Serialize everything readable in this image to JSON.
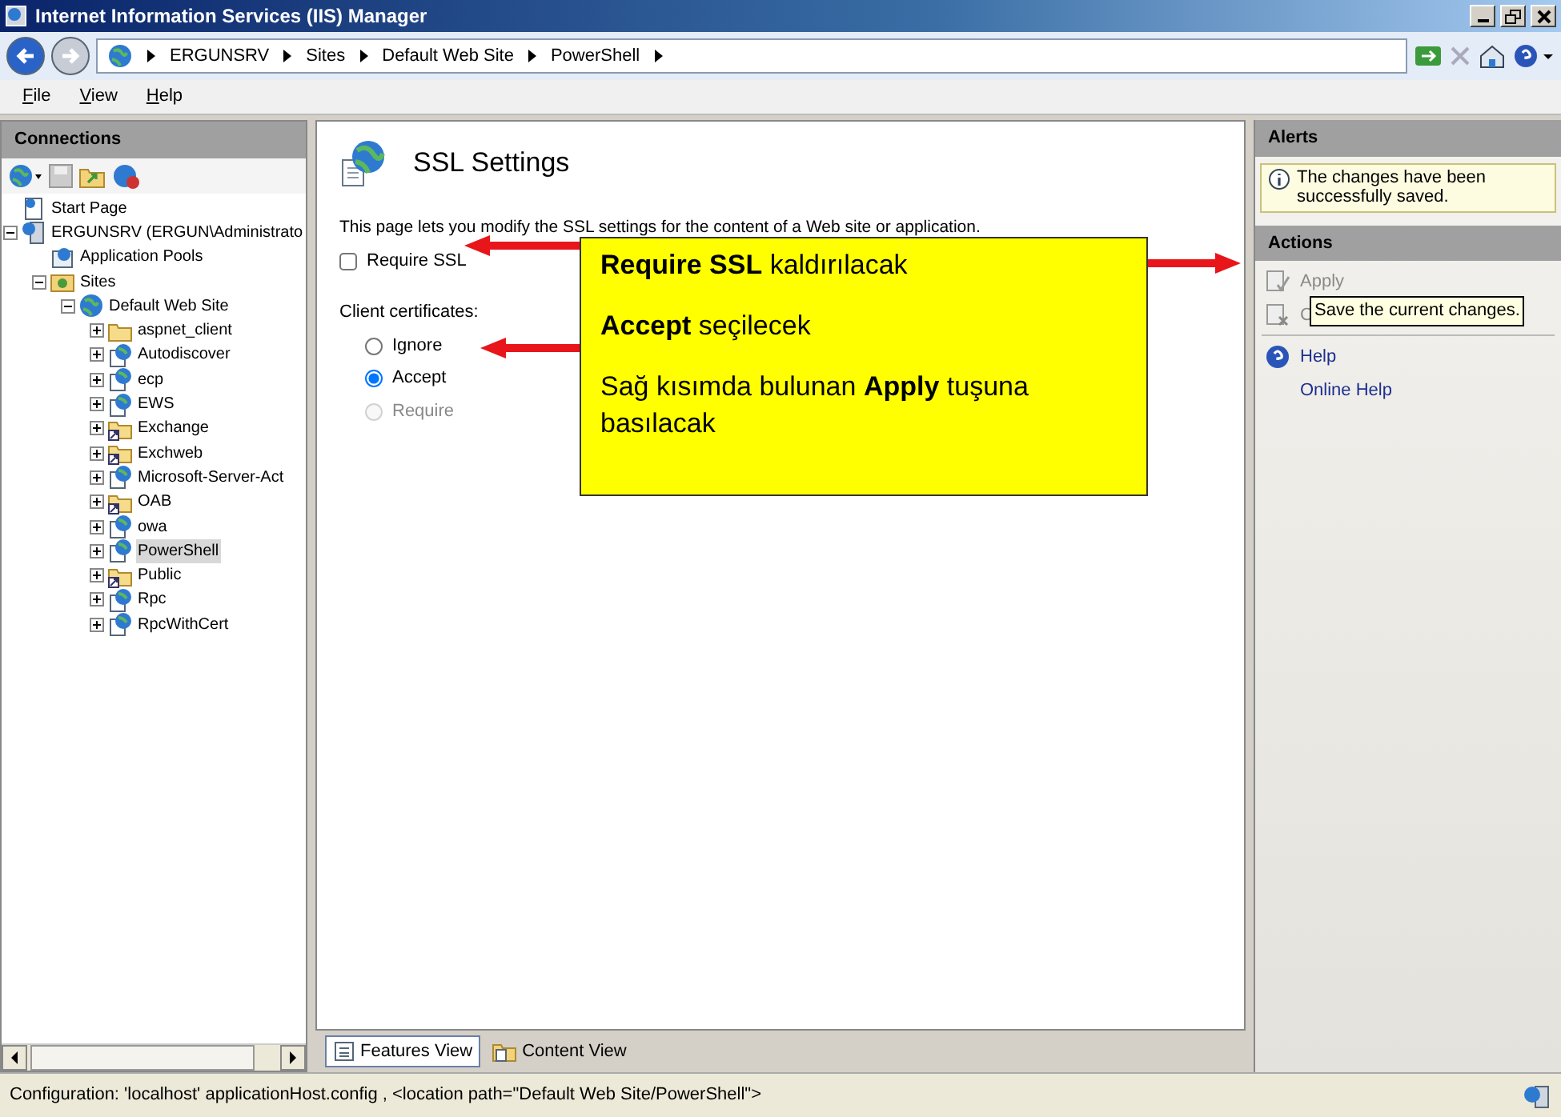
{
  "window": {
    "title": "Internet Information Services (IIS) Manager"
  },
  "address": {
    "segments": [
      "ERGUNSRV",
      "Sites",
      "Default Web Site",
      "PowerShell"
    ]
  },
  "menu": [
    "File",
    "View",
    "Help"
  ],
  "connections": {
    "title": "Connections",
    "tree": [
      {
        "label": "Start Page",
        "kind": "page",
        "selected": false
      },
      {
        "label": "ERGUNSRV (ERGUN\\Administrato",
        "kind": "server",
        "selected": false,
        "expanded": true,
        "children": [
          {
            "label": "Application Pools",
            "kind": "pool",
            "selected": false
          },
          {
            "label": "Sites",
            "kind": "sites",
            "selected": false,
            "expanded": true,
            "children": [
              {
                "label": "Default Web Site",
                "kind": "globe",
                "selected": false,
                "expanded": true,
                "children": [
                  {
                    "label": "aspnet_client",
                    "kind": "folder",
                    "selected": false,
                    "expanded": false
                  },
                  {
                    "label": "Autodiscover",
                    "kind": "app",
                    "selected": false,
                    "expanded": false
                  },
                  {
                    "label": "ecp",
                    "kind": "app",
                    "selected": false,
                    "expanded": false
                  },
                  {
                    "label": "EWS",
                    "kind": "app",
                    "selected": false,
                    "expanded": false
                  },
                  {
                    "label": "Exchange",
                    "kind": "vdir",
                    "selected": false,
                    "expanded": false
                  },
                  {
                    "label": "Exchweb",
                    "kind": "vdir",
                    "selected": false,
                    "expanded": false
                  },
                  {
                    "label": "Microsoft-Server-Act",
                    "kind": "app",
                    "selected": false,
                    "expanded": false
                  },
                  {
                    "label": "OAB",
                    "kind": "vdir",
                    "selected": false,
                    "expanded": false
                  },
                  {
                    "label": "owa",
                    "kind": "app",
                    "selected": false,
                    "expanded": false
                  },
                  {
                    "label": "PowerShell",
                    "kind": "app",
                    "selected": true,
                    "expanded": false
                  },
                  {
                    "label": "Public",
                    "kind": "vdir",
                    "selected": false,
                    "expanded": false
                  },
                  {
                    "label": "Rpc",
                    "kind": "app",
                    "selected": false,
                    "expanded": false
                  },
                  {
                    "label": "RpcWithCert",
                    "kind": "app",
                    "selected": false,
                    "expanded": false
                  }
                ]
              }
            ]
          }
        ]
      }
    ]
  },
  "center": {
    "title": "SSL Settings",
    "description": "This page lets you modify the SSL settings for the content of a Web site or application.",
    "require_ssl": {
      "label": "Require SSL",
      "checked": false
    },
    "client_certificates": {
      "label": "Client certificates:",
      "options": [
        {
          "label": "Ignore",
          "selected": false,
          "disabled": false
        },
        {
          "label": "Accept",
          "selected": true,
          "disabled": false
        },
        {
          "label": "Require",
          "selected": false,
          "disabled": true
        }
      ]
    },
    "callout": [
      "**Require SSL** kaldırılacak",
      "**Accept** seçilecek",
      "Sağ kısımda bulunan **Apply** tuşuna basılacak"
    ],
    "view_tabs": [
      {
        "label": "Features View",
        "selected": true
      },
      {
        "label": "Content View",
        "selected": false
      }
    ]
  },
  "alerts": {
    "title": "Alerts",
    "message": "The changes have been successfully saved."
  },
  "actions": {
    "title": "Actions",
    "items": [
      {
        "label": "Apply",
        "kind": "apply",
        "disabled": true
      },
      {
        "label": "C",
        "kind": "cancel",
        "disabled": true
      },
      {
        "label": "Help",
        "kind": "help",
        "disabled": false
      },
      {
        "label": "Online Help",
        "kind": "link",
        "disabled": false
      }
    ],
    "tooltip": "Save the current changes."
  },
  "status_bar": {
    "text": "Configuration: 'localhost' applicationHost.config , <location path=\"Default Web Site/PowerShell\">"
  }
}
